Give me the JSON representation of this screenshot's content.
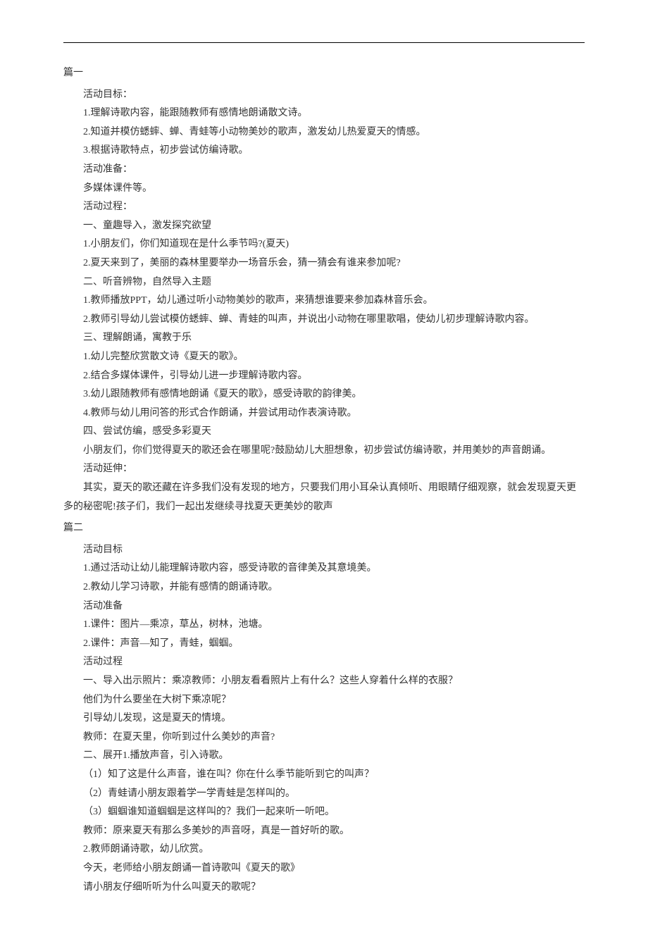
{
  "sections": [
    {
      "heading": "篇一",
      "lines": [
        "活动目标：",
        "1.理解诗歌内容，能跟随教师有感情地朗诵散文诗。",
        "2.知道并模仿蟋蟀、蝉、青蛙等小动物美妙的歌声，激发幼儿热爱夏天的情感。",
        "3.根据诗歌特点，初步尝试仿编诗歌。",
        "活动准备：",
        "多媒体课件等。",
        "活动过程：",
        "一、童趣导入，激发探究欲望",
        "1.小朋友们，你们知道现在是什么季节吗?(夏天)",
        "2.夏天来到了，美丽的森林里要举办一场音乐会，猜一猜会有谁来参加呢?",
        "二、听音辨物，自然导入主题",
        "1.教师播放PPT，幼儿通过听小动物美妙的歌声，来猜想谁要来参加森林音乐会。",
        "2.教师引导幼儿尝试模仿蟋蟀、蝉、青蛙的叫声，并说出小动物在哪里歌唱，使幼儿初步理解诗歌内容。",
        "三、理解朗诵，寓教于乐",
        "1.幼儿完整欣赏散文诗《夏天的歌》。",
        "2.结合多媒体课件，引导幼儿进一步理解诗歌内容。",
        "3.幼儿跟随教师有感情地朗诵《夏天的歌》，感受诗歌的韵律美。",
        "4.教师与幼儿用问答的形式合作朗诵，并尝试用动作表演诗歌。",
        "四、尝试仿编，感受多彩夏天",
        "小朋友们，你们觉得夏天的歌还会在哪里呢?鼓励幼儿大胆想象，初步尝试仿编诗歌，并用美妙的声音朗诵。",
        "活动延伸：",
        "其实，夏天的歌还藏在许多我们没有发现的地方，只要我们用小耳朵认真倾听、用眼睛仔细观察，就会发现夏天更多的秘密呢!孩子们，我们一起出发继续寻找夏天更美妙的歌声"
      ]
    },
    {
      "heading": "篇二",
      "lines": [
        "活动目标",
        "1.通过活动让幼儿能理解诗歌内容，感受诗歌的音律美及其意境美。",
        "2.教幼儿学习诗歌，并能有感情的朗诵诗歌。",
        "活动准备",
        "1.课件：图片—乘凉，草丛，树林，池塘。",
        "2.课件：声音—知了，青蛙，蝈蝈。",
        "活动过程",
        "一、导入出示照片：乘凉教师：小朋友看看照片上有什么？这些人穿着什么样的衣服？",
        "他们为什么要坐在大树下乘凉呢？",
        "引导幼儿发现，这是夏天的情境。",
        "教师：在夏天里，你听到过什么美妙的声音?",
        "二、展开1.播放声音，引入诗歌。",
        "（1）知了这是什么声音，谁在叫？你在什么季节能听到它的叫声？",
        "（2）青蛙请小朋友跟着学一学青蛙是怎样叫的。",
        "（3）蝈蝈谁知道蝈蝈是这样叫的？我们一起来听一听吧。",
        "教师：原来夏天有那么多美妙的声音呀，真是一首好听的歌。",
        "2.教师朗诵诗歌，幼儿欣赏。",
        "今天，老师给小朋友朗诵一首诗歌叫《夏天的歌》",
        "请小朋友仔细听听为什么叫夏天的歌呢？"
      ]
    }
  ]
}
